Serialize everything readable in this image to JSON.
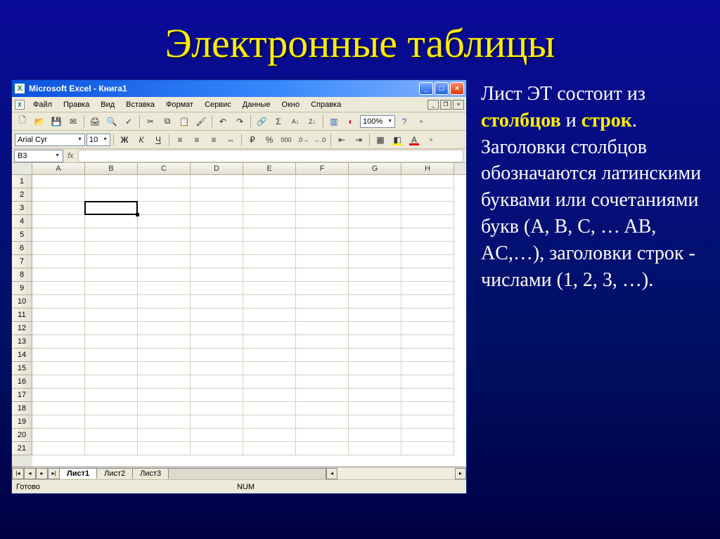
{
  "slide": {
    "title": "Электронные таблицы"
  },
  "titlebar": {
    "text": "Microsoft Excel - Книга1"
  },
  "menu": {
    "items": [
      "Файл",
      "Правка",
      "Вид",
      "Вставка",
      "Формат",
      "Сервис",
      "Данные",
      "Окно",
      "Справка"
    ]
  },
  "toolbar1": {
    "zoom": "100%"
  },
  "toolbar2": {
    "font_name": "Arial Cyr",
    "font_size": "10"
  },
  "namebox": {
    "value": "B3"
  },
  "columns": [
    "A",
    "B",
    "C",
    "D",
    "E",
    "F",
    "G",
    "H"
  ],
  "rows": [
    "1",
    "2",
    "3",
    "4",
    "5",
    "6",
    "7",
    "8",
    "9",
    "10",
    "11",
    "12",
    "13",
    "14",
    "15",
    "16",
    "17",
    "18",
    "19",
    "20",
    "21"
  ],
  "active_cell": {
    "col": 1,
    "row": 2
  },
  "sheets": {
    "tabs": [
      "Лист1",
      "Лист2",
      "Лист3"
    ],
    "active": 0
  },
  "status": {
    "ready": "Готово",
    "caps": "NUM"
  },
  "description": {
    "t1": "Лист ЭТ состоит из ",
    "t2": "столбцов",
    "t3": " и ",
    "t4": "строк",
    "t5": ". Заголовки столбцов обозначаются латинскими буквами или сочетаниями букв (A, B, C, … AB, AC,…), заголовки строк  - числами (1, 2, 3, …)."
  }
}
